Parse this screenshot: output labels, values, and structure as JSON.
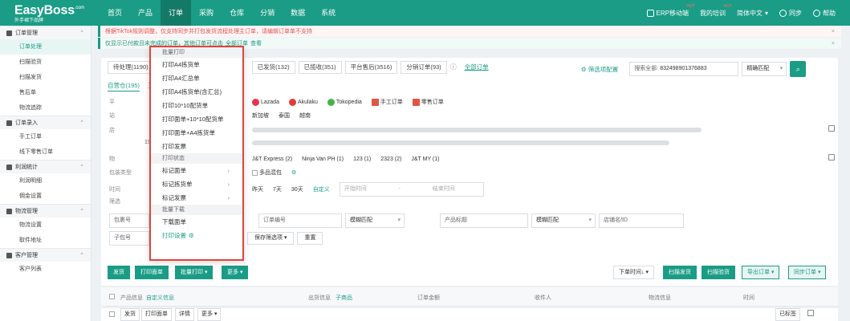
{
  "brand": {
    "name": "EasyBoss",
    "sup": ".com",
    "tagline": "外手裙下品牌"
  },
  "nav": {
    "items": [
      "首页",
      "产品",
      "订单",
      "采购",
      "仓库",
      "分销",
      "数据",
      "系统"
    ],
    "active_index": 2
  },
  "nav_right": {
    "erp_mobile": "ERP移动端",
    "training": "我的培训",
    "lang": "简体中文",
    "sync": "同步",
    "help": "帮助",
    "hot": "HOT"
  },
  "sidebar": {
    "groups": [
      {
        "label": "订单管理",
        "items": [
          "订单处理",
          "扫描验货",
          "扫描发货",
          "售后单",
          "物流追踪"
        ]
      },
      {
        "label": "订单录入",
        "items": [
          "手工订单",
          "线下零售订单"
        ]
      },
      {
        "label": "利润统计",
        "items": [
          "利润明细",
          "佣金设置"
        ]
      },
      {
        "label": "物流管理",
        "items": [
          "物流设置",
          "取件地址"
        ]
      },
      {
        "label": "客户管理",
        "items": [
          "客户列表"
        ]
      }
    ],
    "active_item": "订单处理"
  },
  "banners": {
    "warning": "根据TikTok规则调整，仅支持同步并打包发货流程处理主订单，请编辑订单单不支持",
    "info": "仅显示已付款且未完成的订单，其他订单可点击",
    "info_link": "全部订单",
    "info_link2": "查看"
  },
  "status_tabs": [
    "待处理(1190)",
    "已发货(132)",
    "已揽收(351)",
    "平台售后(3516)",
    "分销订单(93)"
  ],
  "all_orders_link": "全部订单",
  "filter_config": "筛选项配置",
  "search": {
    "prefix": "搜索全部:",
    "value": "832498901376883",
    "match": "精确匹配"
  },
  "sub_tabs": {
    "self": "自营仓(195)",
    "third": "三"
  },
  "filter_labels": {
    "platform": "平",
    "site": "站",
    "store": "店",
    "logistics": "物",
    "pack_type": "包装类型",
    "time": "时间",
    "filter": "筛选"
  },
  "platforms": [
    "Lazada",
    "Akulaku",
    "Tokopedia",
    "手工订单",
    "零售订单"
  ],
  "sites": [
    "新加坡",
    "泰国",
    "越南"
  ],
  "logistics_items": [
    "J&T Express (2)",
    "Ninja Van PH (1)",
    "123 (1)",
    "2323 (2)",
    "J&T MY (1)"
  ],
  "logistics_prefix": "193",
  "pack_multi": "多品混包",
  "time_chips": [
    "昨天",
    "7天",
    "30天",
    "自定义"
  ],
  "time_inputs": {
    "start": "开始时间",
    "sep": "-",
    "end": "结束时间"
  },
  "field_row1": {
    "pkg_no": "包裹号",
    "order_no": "订单编号",
    "fuzzy1": "模糊匹配",
    "product": "产品标题",
    "fuzzy2": "模糊匹配",
    "store_name": "店铺名/ID"
  },
  "field_row2": {
    "sub_no": "子包号",
    "save": "保存筛选项",
    "reset": "重置"
  },
  "actions": {
    "ship": "发货",
    "print_label": "打印面单",
    "batch_print": "批量打印",
    "more": "更多",
    "sort": "下单时间↓",
    "scan_ship": "扫描发货",
    "scan_check": "扫描验货",
    "export": "导出订单",
    "sync": "同步订单"
  },
  "table_head": [
    "产品信息",
    "自定义信息",
    "出货信息",
    "子商品",
    "订单金额",
    "收件人",
    "物流信息",
    "时间"
  ],
  "table_row": [
    "发货",
    "打印面单",
    "详情",
    "更多"
  ],
  "row_right": "已标签",
  "dropdown": {
    "section1": "批量打印",
    "items": [
      {
        "label": "打印A4拣货单",
        "chevron": false
      },
      {
        "label": "打印A4汇总单",
        "chevron": false
      },
      {
        "label": "打印A4拣货单(含汇总)",
        "chevron": false
      },
      {
        "label": "打印10*10配货单",
        "chevron": false
      },
      {
        "label": "打印面单+10*10配货单",
        "chevron": false
      },
      {
        "label": "打印面单+A4拣货单",
        "chevron": false
      },
      {
        "label": "打印发票",
        "chevron": false
      },
      {
        "label": "打印状态",
        "chevron": false
      },
      {
        "label": "标记面单",
        "chevron": true
      },
      {
        "label": "标记拣货单",
        "chevron": true
      },
      {
        "label": "标记发票",
        "chevron": true
      }
    ],
    "section2": "批量下载",
    "download": "下载面单",
    "settings": "打印设置"
  }
}
